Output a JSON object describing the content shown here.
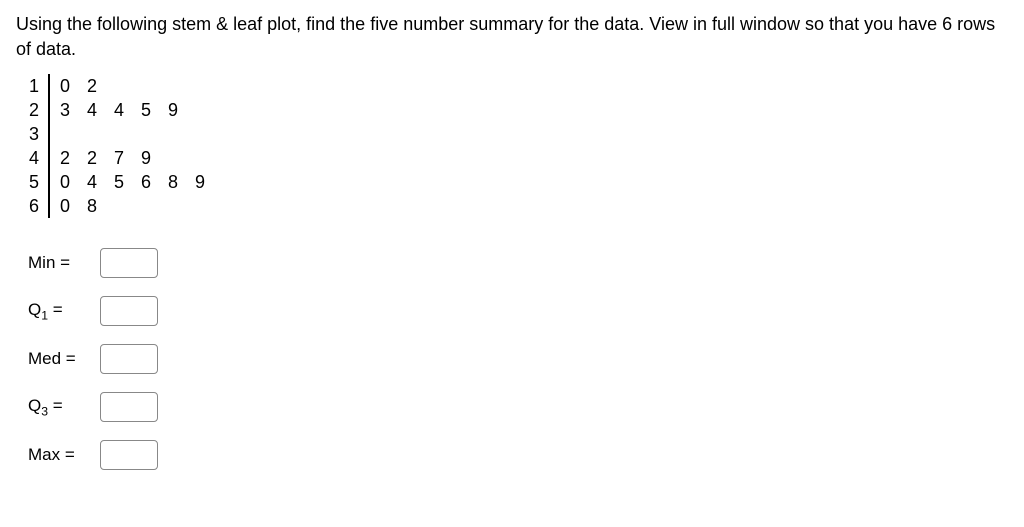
{
  "question": "Using the following stem & leaf plot, find the five number summary for the data. View in full window so that you have 6 rows of data.",
  "stem_leaf": [
    {
      "stem": "1",
      "leaves": "0 2"
    },
    {
      "stem": "2",
      "leaves": "3 4 4 5 9"
    },
    {
      "stem": "3",
      "leaves": ""
    },
    {
      "stem": "4",
      "leaves": "2 2 7 9"
    },
    {
      "stem": "5",
      "leaves": "0 4 5 6 8 9"
    },
    {
      "stem": "6",
      "leaves": "0 8"
    }
  ],
  "answers": {
    "min": {
      "label": "Min =",
      "value": ""
    },
    "q1": {
      "label_prefix": "Q",
      "label_sub": "1",
      "label_suffix": " =",
      "value": ""
    },
    "med": {
      "label": "Med =",
      "value": ""
    },
    "q3": {
      "label_prefix": "Q",
      "label_sub": "3",
      "label_suffix": " =",
      "value": ""
    },
    "max": {
      "label": "Max =",
      "value": ""
    }
  },
  "chart_data": {
    "type": "table",
    "title": "Stem and Leaf Plot",
    "data_values": [
      10,
      12,
      23,
      24,
      24,
      25,
      29,
      42,
      42,
      47,
      49,
      50,
      54,
      55,
      56,
      58,
      59,
      60,
      68
    ]
  }
}
